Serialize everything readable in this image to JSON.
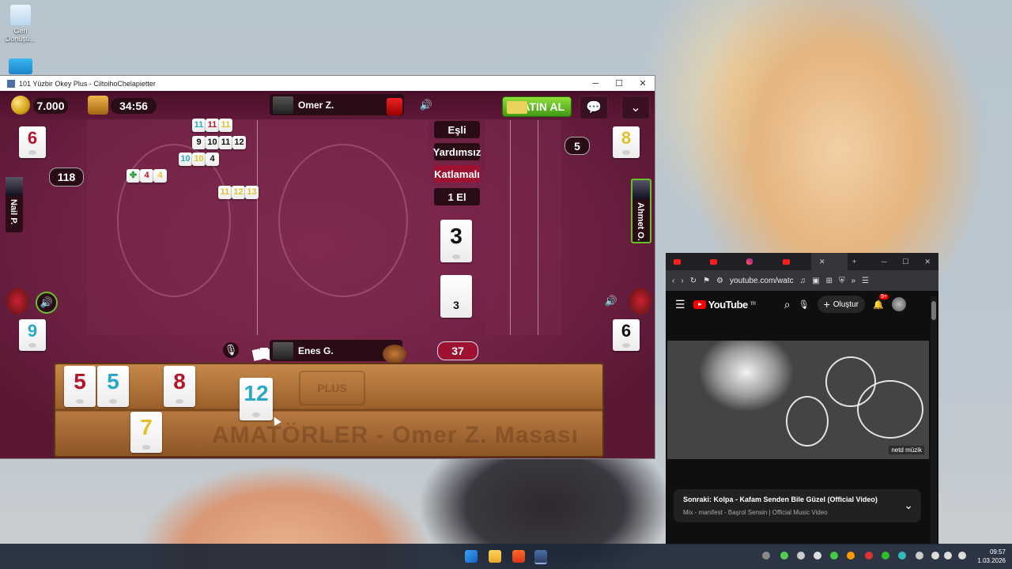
{
  "desktop": {
    "recycle_label_1": "Geri",
    "recycle_label_2": "Dönüşü..."
  },
  "game_window": {
    "title": "101 Yüzbir Okey Plus - CiltoihoChelapietter",
    "controls": {
      "minimize": "─",
      "maximize": "☐",
      "close": "✕"
    },
    "coins": "7.000",
    "timer": "34:56",
    "buy_button": "SATIN AL",
    "top_player": "Omer Z.",
    "bottom_player": "Enes G.",
    "left_player": "Nail P.",
    "right_player": "Ahmet O.",
    "left_score": "118",
    "right_count": "5",
    "deck_count": "37",
    "corner_tiles": {
      "tl": "6",
      "tr": "8",
      "bl": "9",
      "br": "6"
    },
    "options": [
      "Eşli",
      "Yardımsız",
      "Katlamalı",
      "1 El"
    ],
    "indicator_tile": "3",
    "discard_tile": "3",
    "table_sets": [
      [
        {
          "v": "11",
          "c": "blu"
        },
        {
          "v": "11",
          "c": "red"
        },
        {
          "v": "11",
          "c": "yel"
        }
      ],
      [
        {
          "v": "9",
          "c": "blk"
        },
        {
          "v": "10",
          "c": "blk"
        },
        {
          "v": "11",
          "c": "blk"
        },
        {
          "v": "12",
          "c": "blk"
        }
      ],
      [
        {
          "v": "10",
          "c": "blu"
        },
        {
          "v": "10",
          "c": "yel"
        },
        {
          "v": "4",
          "c": "blk"
        }
      ],
      [
        {
          "v": "✤",
          "c": "grn"
        },
        {
          "v": "4",
          "c": "red"
        },
        {
          "v": "4",
          "c": "yel"
        }
      ],
      [
        {
          "v": "11",
          "c": "yel"
        },
        {
          "v": "12",
          "c": "yel"
        },
        {
          "v": "13",
          "c": "yel"
        }
      ]
    ],
    "rack_tiles": [
      {
        "v": "5",
        "c": "red"
      },
      {
        "v": "5",
        "c": "blu"
      },
      {
        "v": "8",
        "c": "red"
      },
      {
        "v": "12",
        "c": "blu"
      },
      {
        "v": "7",
        "c": "yel"
      }
    ],
    "rack_watermark": "AMATÖRLER - Omer Z. Masası",
    "rack_logo": "PLUS"
  },
  "browser": {
    "address": "youtube.com/watc",
    "logo": "YouTube",
    "logo_sup": "TR",
    "create_label": "Oluştur",
    "notif_badge": "9+",
    "next_title": "Sonraki: Kolpa - Kafam Senden Bile Güzel (Official Video)",
    "next_sub": "Mix - manifest - Başrol Sensin | Official Music Video",
    "video_watermark": "netd müzik"
  },
  "taskbar": {
    "time": "09:57",
    "date": "1.03.2026"
  },
  "colors": {
    "board": "#6e1f40",
    "accent_red": "#9c1230",
    "buy_green": "#4fae1c"
  }
}
